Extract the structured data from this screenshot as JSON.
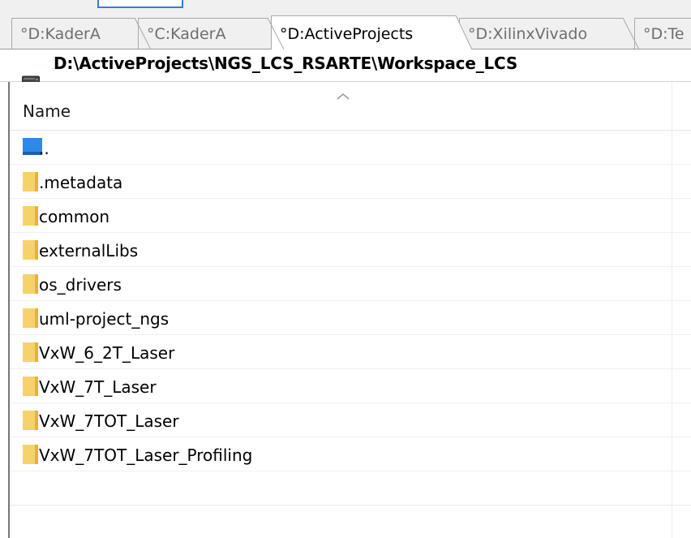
{
  "tabs": [
    {
      "label": "°D:KaderA",
      "active": false
    },
    {
      "label": "°C:KaderA",
      "active": false
    },
    {
      "label": "°D:ActiveProjects",
      "active": true
    },
    {
      "label": "°D:XilinxVivado",
      "active": false
    },
    {
      "label": "°D:Te",
      "active": false
    }
  ],
  "path": {
    "text": "D:\\ActiveProjects\\NGS_LCS_RSARTE\\Workspace_LCS",
    "icon": "drive-icon"
  },
  "list": {
    "column_name": "Name",
    "sort_indicator": "ascending",
    "items": [
      {
        "name": "..",
        "icon": "parent-folder-icon"
      },
      {
        "name": ".metadata",
        "icon": "folder-icon"
      },
      {
        "name": "common",
        "icon": "folder-icon"
      },
      {
        "name": "externalLibs",
        "icon": "folder-icon"
      },
      {
        "name": "os_drivers",
        "icon": "folder-icon"
      },
      {
        "name": "uml-project_ngs",
        "icon": "folder-icon"
      },
      {
        "name": "VxW_6_2T_Laser",
        "icon": "folder-icon"
      },
      {
        "name": "VxW_7T_Laser",
        "icon": "folder-icon"
      },
      {
        "name": "VxW_7TOT_Laser",
        "icon": "folder-icon"
      },
      {
        "name": "VxW_7TOT_Laser_Profiling",
        "icon": "folder-icon"
      }
    ]
  },
  "colors": {
    "folder": "#f6d26b",
    "folder_shade": "#e6b432",
    "parent_blue": "#2b8ae6",
    "accent": "#2f7fe0"
  }
}
